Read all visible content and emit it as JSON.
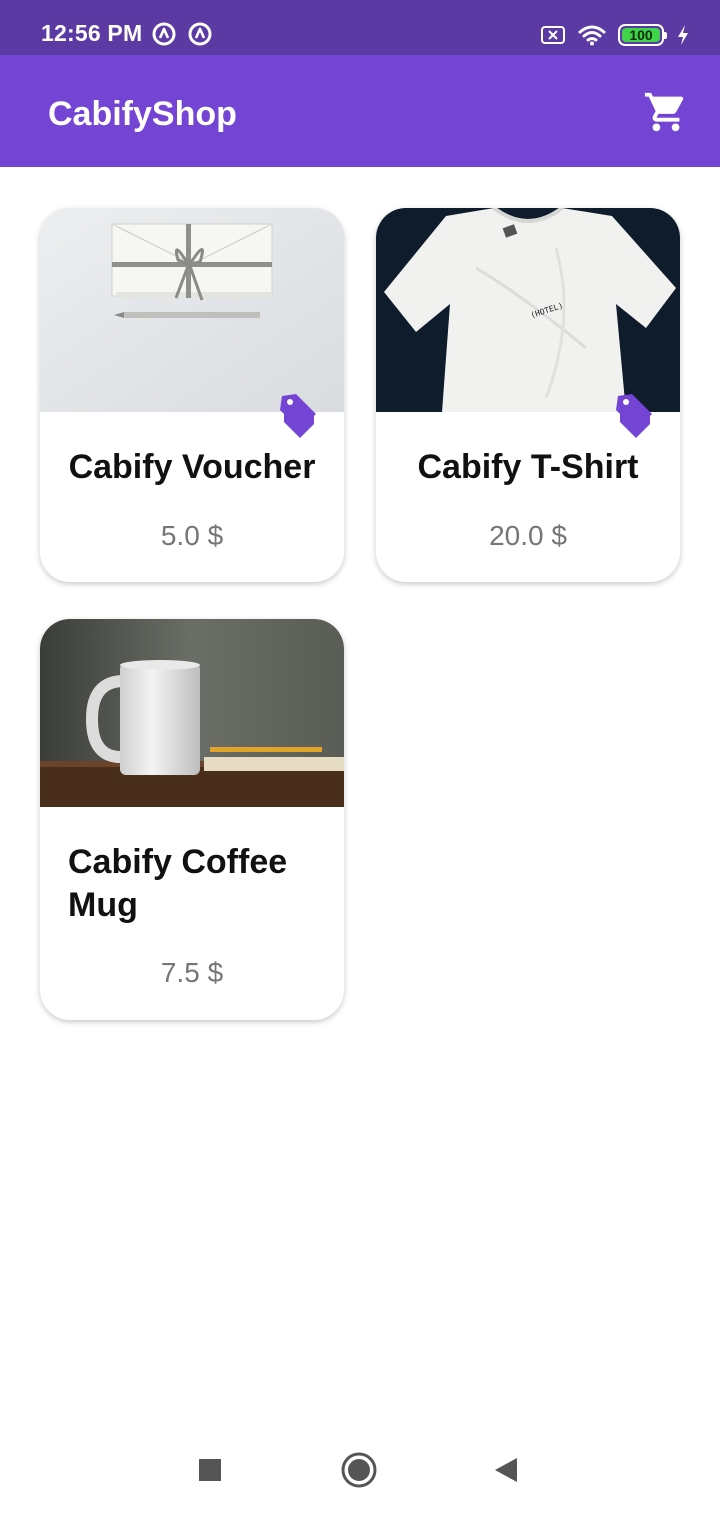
{
  "status_bar": {
    "time": "12:56 PM",
    "battery_level": "100",
    "icons": [
      "app-notification-icon",
      "app-notification-icon",
      "no-sim-icon",
      "wifi-icon",
      "battery-icon",
      "charging-icon"
    ]
  },
  "app_bar": {
    "title": "CabifyShop",
    "cart_icon": "cart-icon"
  },
  "products": [
    {
      "name": "Cabify Voucher",
      "price": "5.0 $",
      "has_discount_tag": true,
      "image": "envelope-with-ribbon-and-pencil"
    },
    {
      "name": "Cabify T-Shirt",
      "price": "20.0 $",
      "has_discount_tag": true,
      "image": "white-tshirt-on-dark-background",
      "shirt_print": "(HOTEL)"
    },
    {
      "name": "Cabify Coffee Mug",
      "price": "7.5 $",
      "has_discount_tag": false,
      "image": "white-mug-on-wooden-table"
    }
  ],
  "colors": {
    "status_bar": "#5c3aa3",
    "app_bar": "#7444d4",
    "accent": "#7444d4",
    "price_text": "#767676"
  },
  "nav_bar": {
    "icons": [
      "recents-square-icon",
      "home-circle-icon",
      "back-triangle-icon"
    ]
  }
}
